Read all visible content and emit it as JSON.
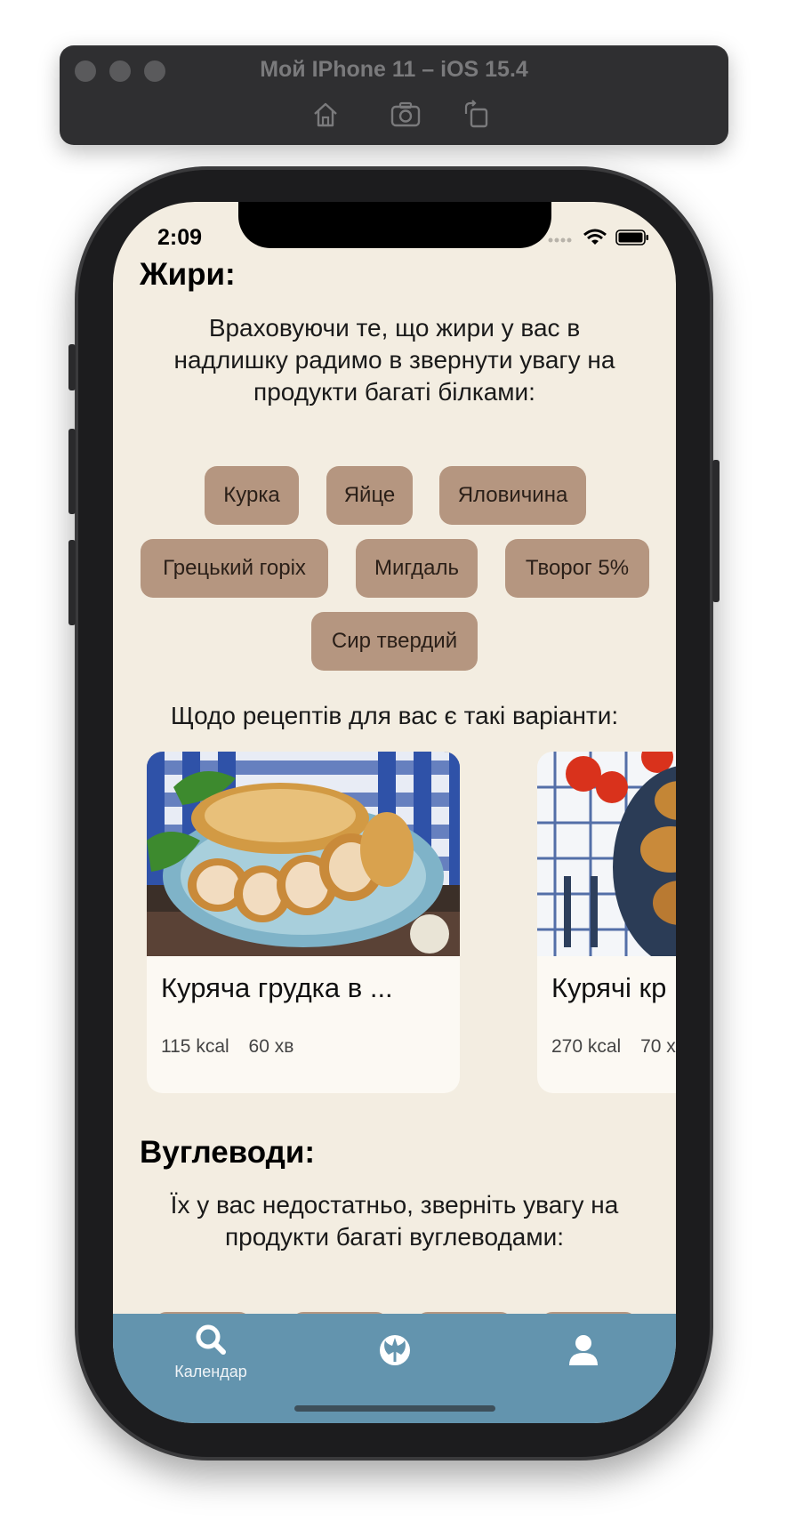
{
  "simulator": {
    "title": "Мой IPhone 11 – iOS 15.4",
    "buttons": [
      "home-icon",
      "screenshot-icon",
      "rotate-icon"
    ]
  },
  "status_bar": {
    "time": "2:09"
  },
  "fats": {
    "heading": "Жири:",
    "description": "Враховуючи те, що жири у вас в надлишку радимо в звернути увагу на продукти багаті білками:",
    "chips": [
      "Курка",
      "Яйце",
      "Яловичина",
      "Грецький горіх",
      "Мигдаль",
      "Творог 5%",
      "Сир твердий"
    ],
    "recipes_intro": "Щодо рецептів для вас є такі варіанти:",
    "recipes": [
      {
        "title": "Куряча грудка в ...",
        "kcal": "115 kcal",
        "time": "60 хв"
      },
      {
        "title": "Курячі кр",
        "kcal": "270 kcal",
        "time": "70 х"
      }
    ]
  },
  "carbs": {
    "heading": "Вуглеводи:",
    "description": "Їх у вас недостатньо, зверніть увагу на продукти багаті вуглеводами:"
  },
  "tabbar": {
    "items": [
      {
        "icon": "search-icon",
        "label": "Календар"
      },
      {
        "icon": "rebel-icon",
        "label": ""
      },
      {
        "icon": "person-icon",
        "label": ""
      }
    ]
  },
  "colors": {
    "background": "#f3ede1",
    "chip": "#b59680",
    "tabbar": "#6394ae",
    "card": "#fcf9f3"
  }
}
